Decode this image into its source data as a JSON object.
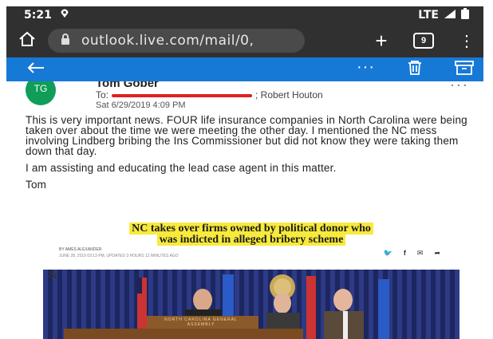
{
  "status": {
    "time": "5:21",
    "network": "LTE"
  },
  "browser": {
    "url": "outlook.live.com/mail/0,",
    "tab_count": "9"
  },
  "email": {
    "avatar_initials": "TG",
    "sender": "Tom Gober",
    "to_label": "To:",
    "cc": "; Robert Houton",
    "date": "Sat 6/29/2019 4:09 PM",
    "paragraphs": [
      "This is very important news. FOUR life insurance companies in North Carolina were being taken over about the time we were meeting the other day. I mentioned the NC mess involving Lindberg bribing the Ins Commissioner but did not know they were taking them down that day.",
      "I am assisting and educating the lead case agent in this matter.",
      "Tom"
    ]
  },
  "article": {
    "headline_1": "NC takes over firms owned by political donor who",
    "headline_2": "was indicted in alleged bribery scheme",
    "byline": "BY AMES ALEXANDER",
    "dateline": "JUNE 28, 2019 03:13 PM, UPDATED 3 HOURS 12 MINUTES AGO",
    "ampersand": "&",
    "podium_text": "NORTH CAROLINA GENERAL ASSEMBLY"
  },
  "colors": {
    "app_bar": "#1779d6",
    "browser_bg": "#303030",
    "avatar": "#0f9d58",
    "highlight": "#f7ea3c"
  }
}
